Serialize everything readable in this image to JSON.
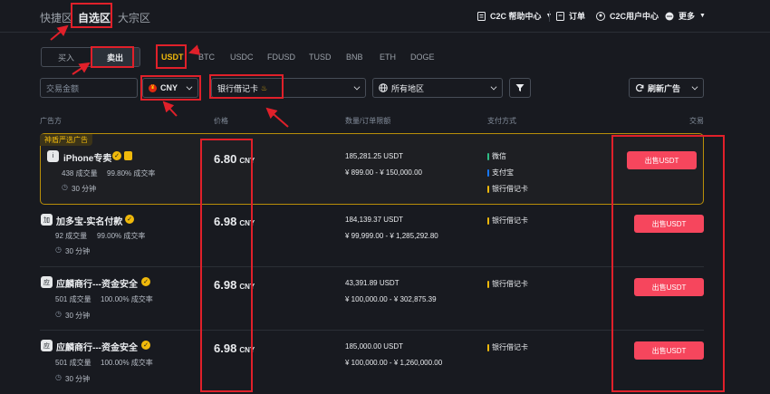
{
  "nav": {
    "tabs": [
      "快捷区",
      "自选区",
      "大宗区"
    ],
    "right": {
      "help": "C2C 帮助中心",
      "orders": "订单",
      "user_center": "C2C用户中心",
      "more": "更多"
    }
  },
  "trade_toggle": {
    "buy": "买入",
    "sell": "卖出"
  },
  "coins": [
    "USDT",
    "BTC",
    "USDC",
    "FDUSD",
    "TUSD",
    "BNB",
    "ETH",
    "DOGE"
  ],
  "filters": {
    "amount_placeholder": "交易金额",
    "currency": "CNY",
    "payment": "银行借记卡",
    "region": "所有地区",
    "refresh": "刷新广告"
  },
  "columns": {
    "advertiser": "广告方",
    "price": "价格",
    "quantity_limit": "数量/订单限额",
    "payment_method": "支付方式",
    "trade": "交易"
  },
  "featured_label": "神盾严选广告",
  "ads": [
    {
      "merchant": "iPhone专卖",
      "avatar": "i",
      "trades": "438 成交量",
      "completion": "99.80% 成交率",
      "time": "30 分钟",
      "price": "6.80",
      "currency": "CNY",
      "quantity": "185,281.25 USDT",
      "limit": "¥ 899.00 - ¥ 150,000.00",
      "payments": [
        {
          "name": "微信",
          "color": "#2ebd85"
        },
        {
          "name": "支付宝",
          "color": "#1677ff"
        },
        {
          "name": "银行借记卡",
          "color": "#f0b90b"
        }
      ],
      "button": "出售USDT"
    },
    {
      "merchant": "加多宝-实名付款",
      "avatar": "加",
      "trades": "92 成交量",
      "completion": "99.00% 成交率",
      "time": "30 分钟",
      "price": "6.98",
      "currency": "CNY",
      "quantity": "184,139.37 USDT",
      "limit": "¥ 99,999.00 - ¥ 1,285,292.80",
      "payments": [
        {
          "name": "银行借记卡",
          "color": "#f0b90b"
        }
      ],
      "button": "出售USDT"
    },
    {
      "merchant": "应麟商行---资金安全",
      "avatar": "应",
      "trades": "501 成交量",
      "completion": "100.00% 成交率",
      "time": "30 分钟",
      "price": "6.98",
      "currency": "CNY",
      "quantity": "43,391.89 USDT",
      "limit": "¥ 100,000.00 - ¥ 302,875.39",
      "payments": [
        {
          "name": "银行借记卡",
          "color": "#f0b90b"
        }
      ],
      "button": "出售USDT"
    },
    {
      "merchant": "应麟商行---资金安全",
      "avatar": "应",
      "trades": "501 成交量",
      "completion": "100.00% 成交率",
      "time": "30 分钟",
      "price": "6.98",
      "currency": "CNY",
      "quantity": "185,000.00 USDT",
      "limit": "¥ 100,000.00 - ¥ 1,260,000.00",
      "payments": [
        {
          "name": "银行借记卡",
          "color": "#f0b90b"
        }
      ],
      "button": "出售USDT"
    }
  ],
  "colors": {
    "background": "#181a20",
    "accent": "#f0b90b",
    "sell": "#f6465d",
    "annotation": "#e0202a"
  }
}
